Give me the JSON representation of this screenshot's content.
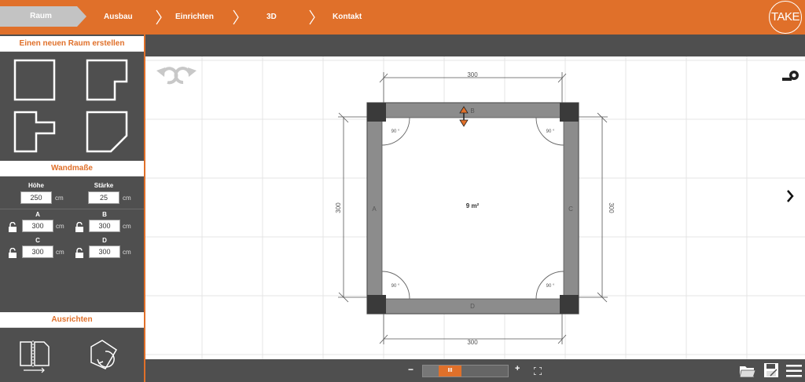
{
  "nav": {
    "steps": [
      {
        "label": "Raum",
        "active": true
      },
      {
        "label": "Ausbau"
      },
      {
        "label": "Einrichten"
      },
      {
        "label": "3D"
      },
      {
        "label": "Kontakt"
      }
    ],
    "logo": "TAKE"
  },
  "sidebar": {
    "new_room_title": "Einen neuen Raum erstellen",
    "room_shapes": [
      "square-room",
      "notched-corner-room",
      "t-shaped-room",
      "cut-corner-room"
    ],
    "wall_title": "Wandmaße",
    "height_label": "Höhe",
    "height_value": "250",
    "thickness_label": "Stärke",
    "thickness_value": "25",
    "unit": "cm",
    "walls": [
      {
        "label": "A",
        "value": "300"
      },
      {
        "label": "B",
        "value": "300"
      },
      {
        "label": "C",
        "value": "300"
      },
      {
        "label": "D",
        "value": "300"
      }
    ],
    "align_title": "Ausrichten"
  },
  "canvas": {
    "dim_top": "300",
    "dim_bottom": "300",
    "dim_left": "300",
    "dim_right": "300",
    "wall_a": "A",
    "wall_b": "B",
    "wall_c": "C",
    "wall_d": "D",
    "area": "9 m²",
    "angle": "90 °"
  },
  "bottom": {
    "zoom_minus": "−",
    "zoom_plus": "+"
  },
  "colors": {
    "accent": "#e0702a",
    "panel": "#4f4f4f",
    "wall": "#8c8c8c"
  }
}
